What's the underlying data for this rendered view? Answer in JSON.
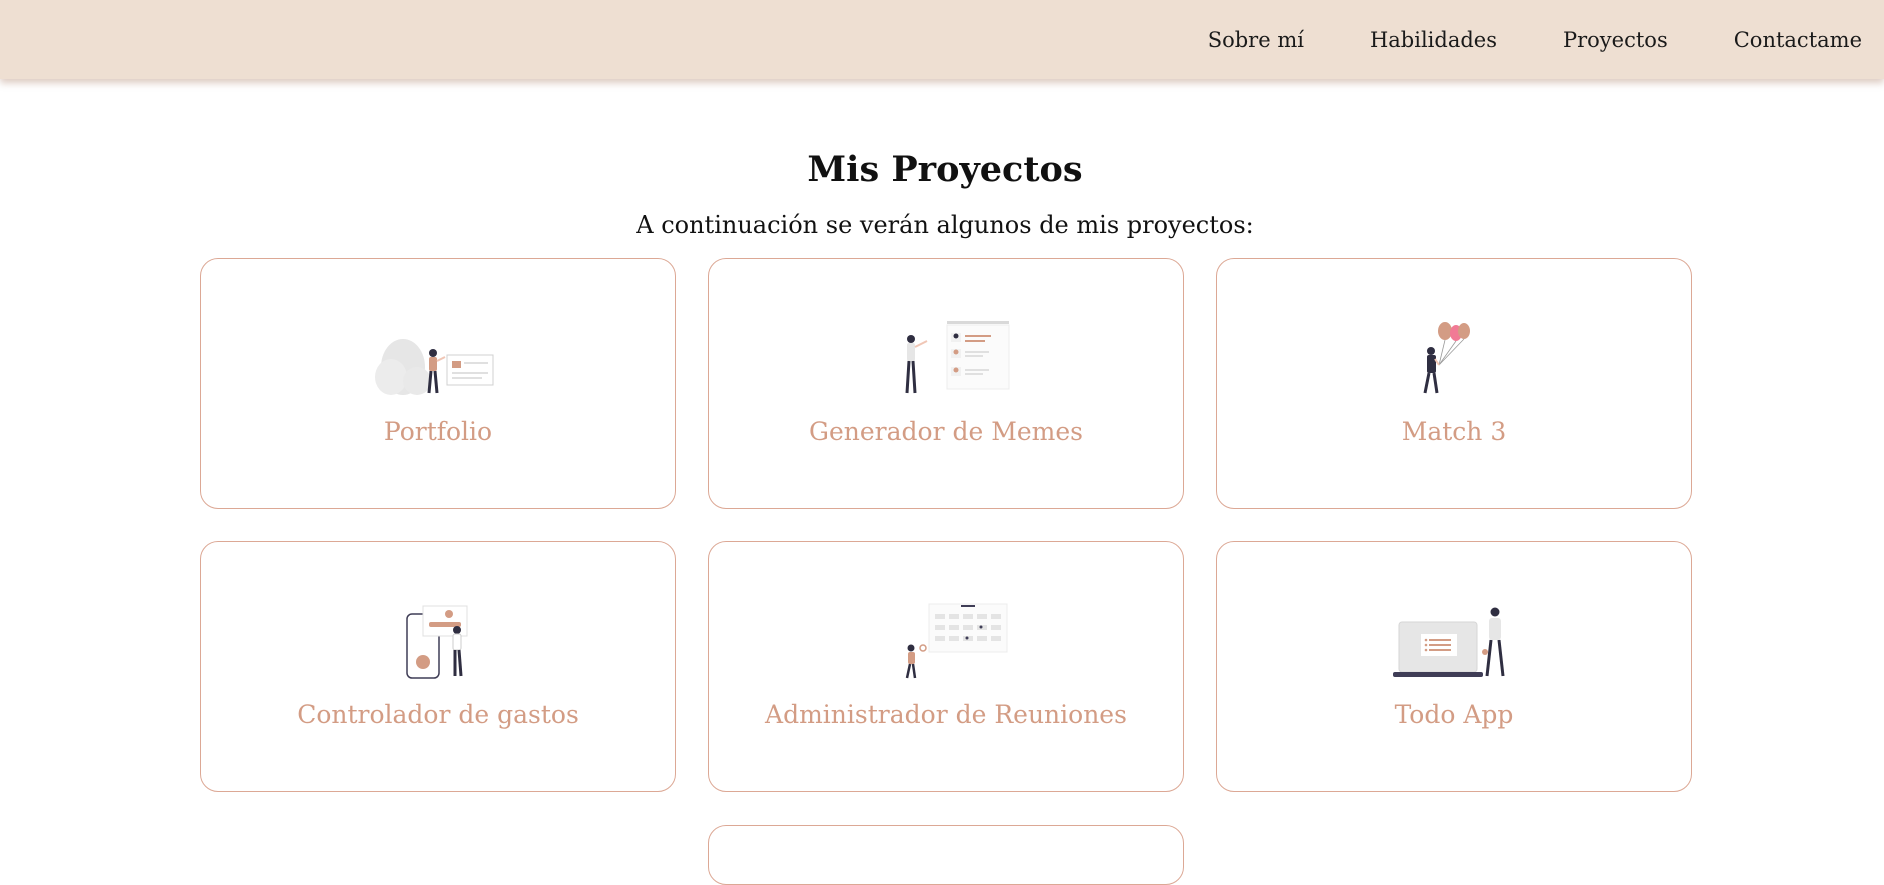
{
  "nav": {
    "items": [
      {
        "label": "Sobre mí"
      },
      {
        "label": "Habilidades"
      },
      {
        "label": "Proyectos"
      },
      {
        "label": "Contactame"
      }
    ]
  },
  "projects_section": {
    "title": "Mis Proyectos",
    "subtitle": "A continuación se verán algunos de mis proyectos:",
    "cards": [
      {
        "title": "Portfolio",
        "icon": "portfolio-illustration-icon"
      },
      {
        "title": "Generador de Memes",
        "icon": "meme-generator-illustration-icon"
      },
      {
        "title": "Match 3",
        "icon": "balloons-illustration-icon"
      },
      {
        "title": "Controlador de gastos",
        "icon": "expense-tracker-illustration-icon"
      },
      {
        "title": "Administrador de Reuniones",
        "icon": "calendar-illustration-icon"
      },
      {
        "title": "Todo App",
        "icon": "todo-laptop-illustration-icon"
      }
    ]
  },
  "colors": {
    "navbar_bg": "#eedfd2",
    "accent": "#d39c84",
    "card_border": "#dca895"
  }
}
